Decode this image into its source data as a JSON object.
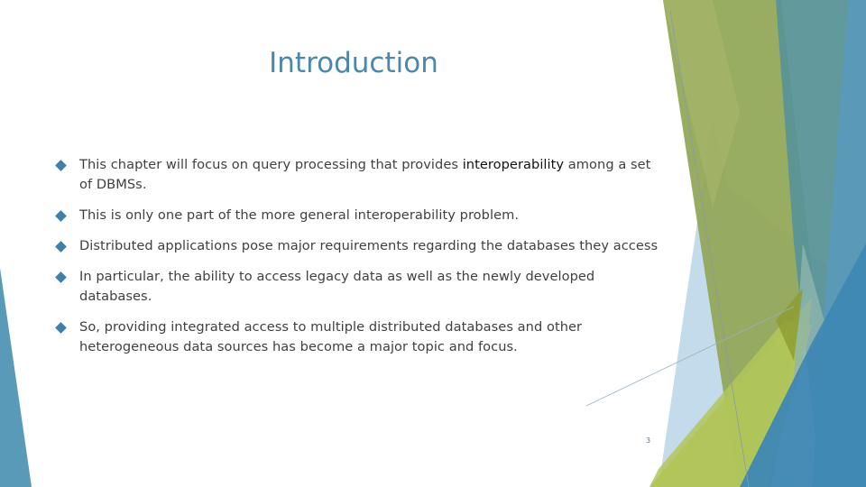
{
  "slide": {
    "title": "Introduction",
    "bullets": [
      {
        "text_before": "This chapter will focus on query processing that provides ",
        "emphasis": "interoperability",
        "text_after": " among a set of DBMSs."
      },
      {
        "text_before": "This is only one part of the more general interoperability problem.",
        "emphasis": "",
        "text_after": ""
      },
      {
        "text_before": "Distributed applications pose major requirements regarding the databases they access",
        "emphasis": "",
        "text_after": ""
      },
      {
        "text_before": "In particular, the ability to access legacy data as well as the newly developed databases.",
        "emphasis": "",
        "text_after": ""
      },
      {
        "text_before": "So, providing integrated access to multiple distributed databases and other heterogeneous data sources has become a major topic and focus.",
        "emphasis": "",
        "text_after": ""
      }
    ],
    "bullet_icon": "diamond-bullet-icon",
    "page_number": "3"
  },
  "theme": {
    "title_color": "#4a88ad",
    "text_color": "#404040",
    "bullet_color": "#3f80ab",
    "accent_green": "#93a95a",
    "accent_lime": "#aac04e",
    "accent_teal": "#5a9498",
    "accent_blue": "#5a9ab9",
    "accent_light_blue": "#bcd7e8"
  }
}
